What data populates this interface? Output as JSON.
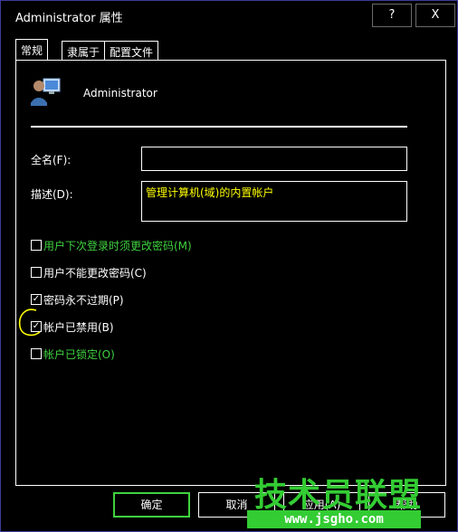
{
  "window": {
    "title": "Administrator 属性",
    "help_button": "?",
    "close_button": "X"
  },
  "tabs": [
    {
      "label": "常规",
      "active": true
    },
    {
      "label": "隶属于",
      "active": false
    },
    {
      "label": "配置文件",
      "active": false
    }
  ],
  "user": {
    "icon": "user-icon",
    "name": "Administrator"
  },
  "form": {
    "fullname_label": "全名(F):",
    "fullname_value": "",
    "description_label": "描述(D):",
    "description_value": "管理计算机(域)的内置帐户"
  },
  "checkboxes": [
    {
      "label": "用户下次登录时须更改密码(M)",
      "checked": false,
      "enabled": false
    },
    {
      "label": "用户不能更改密码(C)",
      "checked": false,
      "enabled": true
    },
    {
      "label": "密码永不过期(P)",
      "checked": true,
      "enabled": true
    },
    {
      "label": "帐户已禁用(B)",
      "checked": true,
      "enabled": true
    },
    {
      "label": "帐户已锁定(O)",
      "checked": false,
      "enabled": false
    }
  ],
  "buttons": {
    "ok": "确定",
    "cancel": "取消",
    "apply": "应用(A)",
    "help": "帮助"
  },
  "watermark": {
    "text": "技术员联盟",
    "url": "www.jsgho.com"
  },
  "colors": {
    "background": "#000000",
    "foreground": "#ffffff",
    "disabled_text": "#3fd23f",
    "input_text": "#ffff00",
    "annotation": "#ffff00"
  }
}
